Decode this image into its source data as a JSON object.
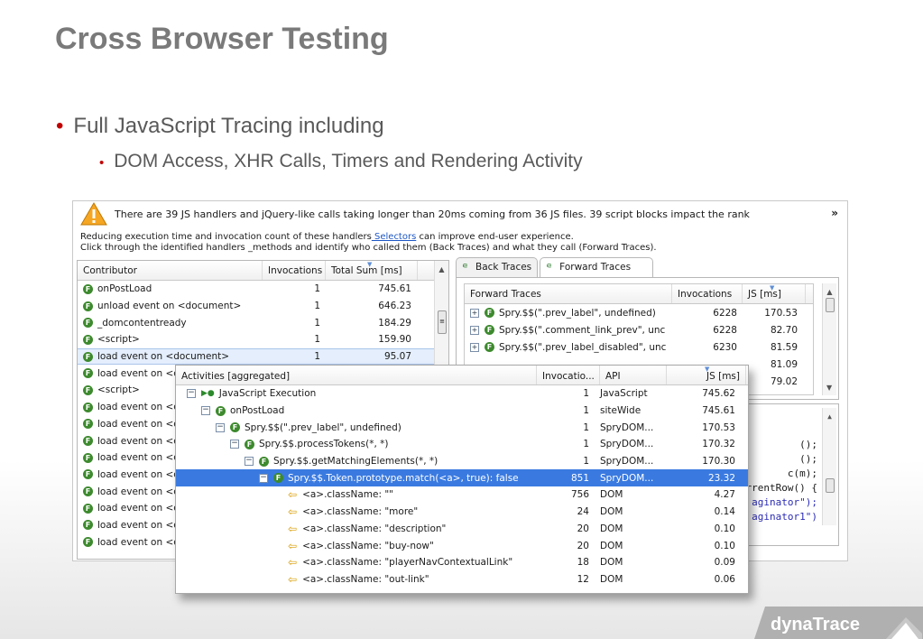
{
  "slide": {
    "title": "Cross Browser Testing",
    "bullet1": "Full JavaScript Tracing including",
    "bullet2": "DOM Access, XHR Calls, Timers and Rendering Activity",
    "bullet_color": "#c00000",
    "logo_text": "dynaTrace"
  },
  "panel": {
    "warning": "There are 39 JS handlers and jQuery-like calls taking longer than 20ms coming from 36 JS files. 39 script blocks impact the rank",
    "desc_line1_pre": "Reducing execution time and invocation count of these handlers",
    "desc_link": " Selectors",
    "desc_line1_post": " can improve end-user experience.",
    "desc_line2": "Click through the identified handlers _methods and identify who called them (Back Traces) and what they call (Forward Traces)."
  },
  "contributors": {
    "headers": [
      "Contributor",
      "Invocations",
      "Total Sum [ms]"
    ],
    "rows": [
      {
        "name": "onPostLoad",
        "inv": "1",
        "sum": "745.61"
      },
      {
        "name": "unload event on <document>",
        "inv": "1",
        "sum": "646.23"
      },
      {
        "name": "_domcontentready",
        "inv": "1",
        "sum": "184.29"
      },
      {
        "name": "<script>",
        "inv": "1",
        "sum": "159.90"
      },
      {
        "name": "load event on <document>",
        "inv": "1",
        "sum": "95.07"
      },
      {
        "name": "load event on <c",
        "inv": "",
        "sum": ""
      },
      {
        "name": "<script>",
        "inv": "",
        "sum": ""
      },
      {
        "name": "load event on <c",
        "inv": "",
        "sum": ""
      },
      {
        "name": "load event on <c",
        "inv": "",
        "sum": ""
      },
      {
        "name": "load event on <c",
        "inv": "",
        "sum": ""
      },
      {
        "name": "load event on <c",
        "inv": "",
        "sum": ""
      },
      {
        "name": "load event on <c",
        "inv": "",
        "sum": ""
      },
      {
        "name": "load event on <c",
        "inv": "",
        "sum": ""
      },
      {
        "name": "load event on <c",
        "inv": "",
        "sum": ""
      },
      {
        "name": "load event on <c",
        "inv": "",
        "sum": ""
      },
      {
        "name": "load event on <c",
        "inv": "",
        "sum": ""
      }
    ]
  },
  "traces": {
    "tab_back": "Back Traces",
    "tab_forward": "Forward Traces",
    "headers": [
      "Forward Traces",
      "Invocations",
      "JS [ms]"
    ],
    "rows": [
      {
        "name": "Spry.$$(\".prev_label\", undefined)",
        "inv": "6228",
        "js": "170.53"
      },
      {
        "name": "Spry.$$(\".comment_link_prev\", unc",
        "inv": "6228",
        "js": "82.70"
      },
      {
        "name": "Spry.$$(\".prev_label_disabled\", unc",
        "inv": "6230",
        "js": "81.59"
      },
      {
        "name": "",
        "inv": "",
        "js": "81.09"
      },
      {
        "name": "",
        "inv": "",
        "js": "79.02"
      }
    ],
    "code": [
      "();",
      "();",
      "c(m);",
      "rrentRow() {",
      "aginator\");",
      "aginator1\")"
    ]
  },
  "activities": {
    "headers": [
      "Activities [aggregated]",
      "Invocatio...",
      "API",
      "JS [ms]"
    ],
    "rows": [
      {
        "name": "JavaScript Execution",
        "inv": "1",
        "api": "JavaScript",
        "js": "745.62"
      },
      {
        "name": "onPostLoad",
        "inv": "1",
        "api": "siteWide",
        "js": "745.61"
      },
      {
        "name": "Spry.$$(\".prev_label\", undefined)",
        "inv": "1",
        "api": "SpryDOM...",
        "js": "170.53"
      },
      {
        "name": "Spry.$$.processTokens(*, *)",
        "inv": "1",
        "api": "SpryDOM...",
        "js": "170.32"
      },
      {
        "name": "Spry.$$.getMatchingElements(*, *)",
        "inv": "1",
        "api": "SpryDOM...",
        "js": "170.30"
      },
      {
        "name": "Spry.$$.Token.prototype.match(<a>, true): false",
        "inv": "851",
        "api": "SpryDOM...",
        "js": "23.32"
      },
      {
        "name": "<a>.className: \"\"",
        "inv": "756",
        "api": "DOM",
        "js": "4.27"
      },
      {
        "name": "<a>.className: \"more\"",
        "inv": "24",
        "api": "DOM",
        "js": "0.14"
      },
      {
        "name": "<a>.className: \"description\"",
        "inv": "20",
        "api": "DOM",
        "js": "0.10"
      },
      {
        "name": "<a>.className: \"buy-now\"",
        "inv": "20",
        "api": "DOM",
        "js": "0.10"
      },
      {
        "name": "<a>.className: \"playerNavContextualLink\"",
        "inv": "18",
        "api": "DOM",
        "js": "0.09"
      },
      {
        "name": "<a>.className: \"out-link\"",
        "inv": "12",
        "api": "DOM",
        "js": "0.06"
      }
    ]
  }
}
